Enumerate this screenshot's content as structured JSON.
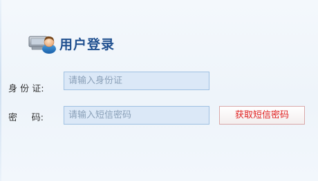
{
  "header": {
    "title": "用户登录",
    "icon": "user-login-icon"
  },
  "form": {
    "id_label": "身 份 证:",
    "id_placeholder": "请输入身份证",
    "code_label": "密     码:",
    "code_placeholder": "请输入短信密码",
    "sms_button_label": "获取短信密码"
  },
  "colors": {
    "title": "#1f4f8f",
    "input_bg": "#dbe8f7",
    "input_border": "#9ec0e2",
    "button_text": "#e02020"
  }
}
